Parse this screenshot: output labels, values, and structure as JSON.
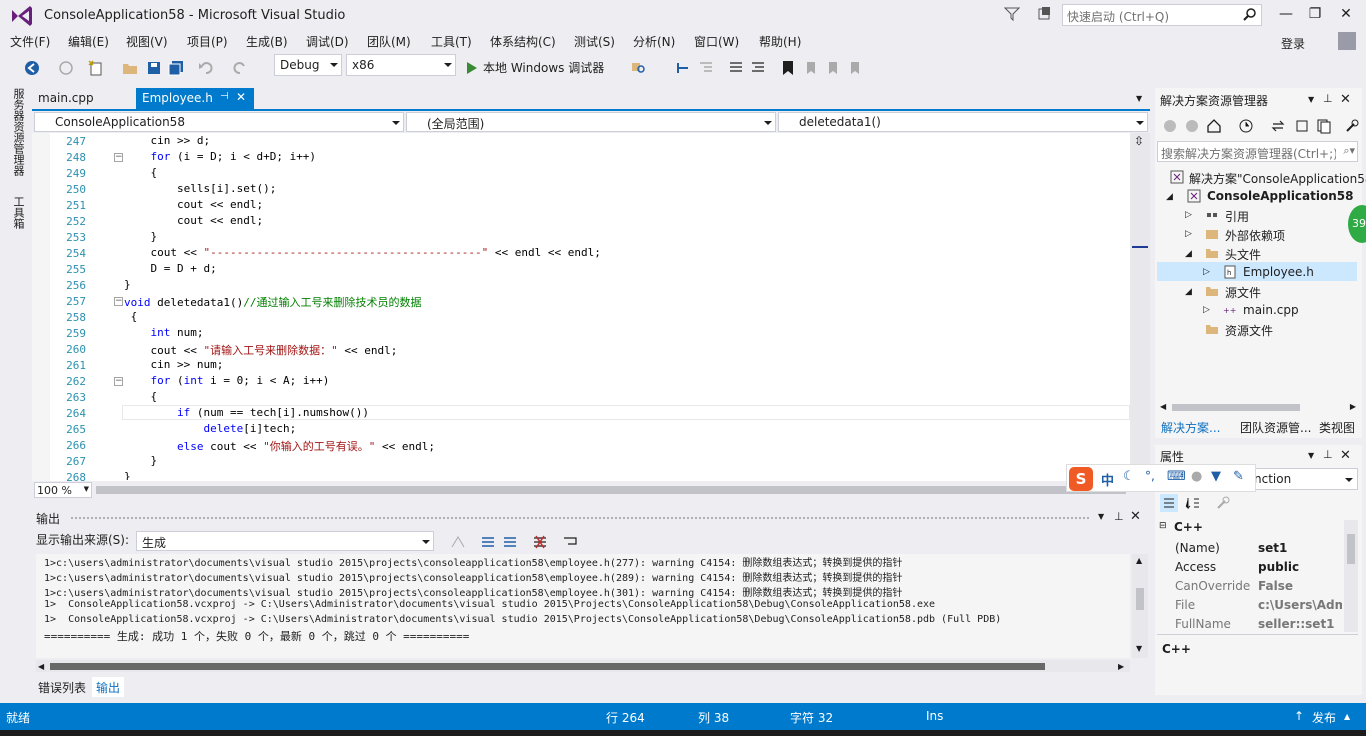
{
  "window": {
    "title": "ConsoleApplication58 - Microsoft Visual Studio",
    "quicklaunch_placeholder": "快速启动 (Ctrl+Q)",
    "login": "登录"
  },
  "menu": [
    "文件(F)",
    "编辑(E)",
    "视图(V)",
    "项目(P)",
    "生成(B)",
    "调试(D)",
    "团队(M)",
    "工具(T)",
    "体系结构(C)",
    "测试(S)",
    "分析(N)",
    "窗口(W)",
    "帮助(H)"
  ],
  "toolbar": {
    "config": "Debug",
    "platform": "x86",
    "run_label": "本地 Windows 调试器"
  },
  "left_strip": {
    "server_explorer": "服务器资源管理器",
    "toolbox": "工具箱"
  },
  "tabs": {
    "main": "main.cpp",
    "employee": "Employee.h"
  },
  "navbar": {
    "project": "ConsoleApplication58",
    "scope": "(全局范围)",
    "member": "deletedata1()"
  },
  "code": {
    "line_numbers": [
      "247",
      "248",
      "249",
      "250",
      "251",
      "252",
      "253",
      "254",
      "255",
      "256",
      "257",
      "258",
      "259",
      "260",
      "261",
      "262",
      "263",
      "264",
      "265",
      "266",
      "267",
      "268"
    ],
    "l247": "    cin >> d;",
    "l248_kw": "    for",
    "l248": " (i = D; i < d+D; i++)",
    "l249": "    {",
    "l250": "        sells[i].set();",
    "l251": "        cout << endl;",
    "l252": "        cout << endl;",
    "l253": "    }",
    "l254_a": "    cout << ",
    "l254_s": "\"-----------------------------------------\"",
    "l254_b": " << endl << endl;",
    "l255": "    D = D + d;",
    "l256": "}",
    "l257_kw": "void",
    "l257": " deletedata1()",
    "l257_cm": "//通过输入工号来删除技术员的数据",
    "l258": " {",
    "l259_kw": "    int",
    "l259": " num;",
    "l260_a": "    cout << ",
    "l260_s": "\"请输入工号来删除数据：\"",
    "l260_b": " << endl;",
    "l261": "    cin >> num;",
    "l262_kw": "    for",
    "l262_a": " (",
    "l262_kw2": "int",
    "l262_b": " i = 0; i < A; i++)",
    "l263": "    {",
    "l264_kw": "        if",
    "l264": " (num == tech[i].numshow())",
    "l265_kw": "            delete",
    "l265": "[i]tech;",
    "l266_kw": "        else",
    "l266_a": " cout << ",
    "l266_s": "\"你输入的工号有误。\"",
    "l266_b": " << endl;",
    "l267": "    }",
    "l268": "}"
  },
  "zoom": "100 %",
  "output": {
    "title": "输出",
    "source_label": "显示输出来源(S):",
    "source_value": "生成",
    "lines": [
      "1>c:\\users\\administrator\\documents\\visual studio 2015\\projects\\consoleapplication58\\employee.h(277): warning C4154: 删除数组表达式；转换到提供的指针",
      "1>c:\\users\\administrator\\documents\\visual studio 2015\\projects\\consoleapplication58\\employee.h(289): warning C4154: 删除数组表达式；转换到提供的指针",
      "1>c:\\users\\administrator\\documents\\visual studio 2015\\projects\\consoleapplication58\\employee.h(301): warning C4154: 删除数组表达式；转换到提供的指针",
      "1>  ConsoleApplication58.vcxproj -> C:\\Users\\Administrator\\documents\\visual studio 2015\\Projects\\ConsoleApplication58\\Debug\\ConsoleApplication58.exe",
      "1>  ConsoleApplication58.vcxproj -> C:\\Users\\Administrator\\documents\\visual studio 2015\\Projects\\ConsoleApplication58\\Debug\\ConsoleApplication58.pdb (Full PDB)",
      "========== 生成: 成功 1 个，失败 0 个，最新 0 个，跳过 0 个 =========="
    ]
  },
  "bottom_tabs": {
    "errors": "错误列表",
    "output": "输出"
  },
  "solution_explorer": {
    "title": "解决方案资源管理器",
    "search_placeholder": "搜索解决方案资源管理器(Ctrl+;)",
    "solution": "解决方案\"ConsoleApplication58\"",
    "project": "ConsoleApplication58",
    "references": "引用",
    "external": "外部依赖项",
    "headers": "头文件",
    "employee": "Employee.h",
    "sources": "源文件",
    "main": "main.cpp",
    "resources": "资源文件",
    "tab_solution": "解决方案...",
    "tab_team": "团队资源管...",
    "tab_class": "类视图"
  },
  "properties": {
    "title": "属性",
    "combo": "nction",
    "category": "C++",
    "rows": [
      {
        "name": "(Name)",
        "value": "set1"
      },
      {
        "name": "Access",
        "value": "public"
      },
      {
        "name": "CanOverride",
        "value": "False"
      },
      {
        "name": "File",
        "value": "c:\\Users\\Adm"
      },
      {
        "name": "FullName",
        "value": "seller::set1"
      }
    ],
    "desc": "C++"
  },
  "ime": {
    "mode": "中"
  },
  "badge": "39",
  "status": {
    "ready": "就绪",
    "row": "行 264",
    "col": "列 38",
    "char": "字符 32",
    "ins": "Ins",
    "publish": "发布"
  },
  "colors": {
    "accent": "#007acc",
    "keyword": "#0000ff",
    "string": "#a31515",
    "comment": "#008000",
    "linenum": "#2b91af"
  }
}
